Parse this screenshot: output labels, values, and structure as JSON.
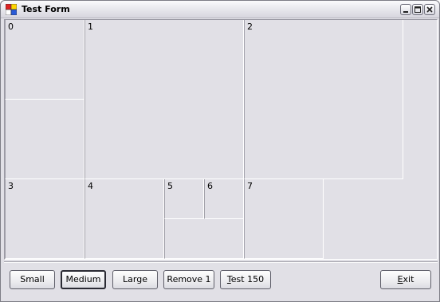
{
  "window": {
    "title": "Test Form"
  },
  "panels": [
    {
      "label": "0"
    },
    {
      "label": "1"
    },
    {
      "label": "2"
    },
    {
      "label": "3"
    },
    {
      "label": "4"
    },
    {
      "label": "5"
    },
    {
      "label": "6"
    },
    {
      "label": "7"
    }
  ],
  "buttons": {
    "small": "Small",
    "medium": "Medium",
    "large": "Large",
    "remove": "Remove 1",
    "test_mnemonic": "T",
    "test_rest": "est 150",
    "exit_mnemonic": "E",
    "exit_rest": "xit"
  },
  "icons": {
    "app": "app-icon",
    "minimize": "minimize-icon",
    "maximize": "maximize-icon",
    "close": "close-icon"
  }
}
